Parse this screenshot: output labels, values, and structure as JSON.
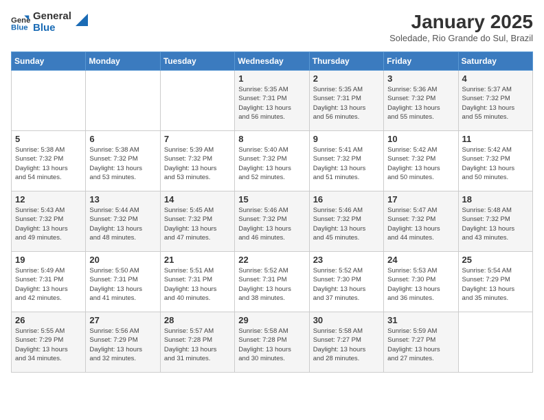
{
  "logo": {
    "text_general": "General",
    "text_blue": "Blue"
  },
  "title": "January 2025",
  "subtitle": "Soledade, Rio Grande do Sul, Brazil",
  "weekdays": [
    "Sunday",
    "Monday",
    "Tuesday",
    "Wednesday",
    "Thursday",
    "Friday",
    "Saturday"
  ],
  "weeks": [
    [
      {
        "day": "",
        "info": ""
      },
      {
        "day": "",
        "info": ""
      },
      {
        "day": "",
        "info": ""
      },
      {
        "day": "1",
        "info": "Sunrise: 5:35 AM\nSunset: 7:31 PM\nDaylight: 13 hours\nand 56 minutes."
      },
      {
        "day": "2",
        "info": "Sunrise: 5:35 AM\nSunset: 7:31 PM\nDaylight: 13 hours\nand 56 minutes."
      },
      {
        "day": "3",
        "info": "Sunrise: 5:36 AM\nSunset: 7:32 PM\nDaylight: 13 hours\nand 55 minutes."
      },
      {
        "day": "4",
        "info": "Sunrise: 5:37 AM\nSunset: 7:32 PM\nDaylight: 13 hours\nand 55 minutes."
      }
    ],
    [
      {
        "day": "5",
        "info": "Sunrise: 5:38 AM\nSunset: 7:32 PM\nDaylight: 13 hours\nand 54 minutes."
      },
      {
        "day": "6",
        "info": "Sunrise: 5:38 AM\nSunset: 7:32 PM\nDaylight: 13 hours\nand 53 minutes."
      },
      {
        "day": "7",
        "info": "Sunrise: 5:39 AM\nSunset: 7:32 PM\nDaylight: 13 hours\nand 53 minutes."
      },
      {
        "day": "8",
        "info": "Sunrise: 5:40 AM\nSunset: 7:32 PM\nDaylight: 13 hours\nand 52 minutes."
      },
      {
        "day": "9",
        "info": "Sunrise: 5:41 AM\nSunset: 7:32 PM\nDaylight: 13 hours\nand 51 minutes."
      },
      {
        "day": "10",
        "info": "Sunrise: 5:42 AM\nSunset: 7:32 PM\nDaylight: 13 hours\nand 50 minutes."
      },
      {
        "day": "11",
        "info": "Sunrise: 5:42 AM\nSunset: 7:32 PM\nDaylight: 13 hours\nand 50 minutes."
      }
    ],
    [
      {
        "day": "12",
        "info": "Sunrise: 5:43 AM\nSunset: 7:32 PM\nDaylight: 13 hours\nand 49 minutes."
      },
      {
        "day": "13",
        "info": "Sunrise: 5:44 AM\nSunset: 7:32 PM\nDaylight: 13 hours\nand 48 minutes."
      },
      {
        "day": "14",
        "info": "Sunrise: 5:45 AM\nSunset: 7:32 PM\nDaylight: 13 hours\nand 47 minutes."
      },
      {
        "day": "15",
        "info": "Sunrise: 5:46 AM\nSunset: 7:32 PM\nDaylight: 13 hours\nand 46 minutes."
      },
      {
        "day": "16",
        "info": "Sunrise: 5:46 AM\nSunset: 7:32 PM\nDaylight: 13 hours\nand 45 minutes."
      },
      {
        "day": "17",
        "info": "Sunrise: 5:47 AM\nSunset: 7:32 PM\nDaylight: 13 hours\nand 44 minutes."
      },
      {
        "day": "18",
        "info": "Sunrise: 5:48 AM\nSunset: 7:32 PM\nDaylight: 13 hours\nand 43 minutes."
      }
    ],
    [
      {
        "day": "19",
        "info": "Sunrise: 5:49 AM\nSunset: 7:31 PM\nDaylight: 13 hours\nand 42 minutes."
      },
      {
        "day": "20",
        "info": "Sunrise: 5:50 AM\nSunset: 7:31 PM\nDaylight: 13 hours\nand 41 minutes."
      },
      {
        "day": "21",
        "info": "Sunrise: 5:51 AM\nSunset: 7:31 PM\nDaylight: 13 hours\nand 40 minutes."
      },
      {
        "day": "22",
        "info": "Sunrise: 5:52 AM\nSunset: 7:31 PM\nDaylight: 13 hours\nand 38 minutes."
      },
      {
        "day": "23",
        "info": "Sunrise: 5:52 AM\nSunset: 7:30 PM\nDaylight: 13 hours\nand 37 minutes."
      },
      {
        "day": "24",
        "info": "Sunrise: 5:53 AM\nSunset: 7:30 PM\nDaylight: 13 hours\nand 36 minutes."
      },
      {
        "day": "25",
        "info": "Sunrise: 5:54 AM\nSunset: 7:29 PM\nDaylight: 13 hours\nand 35 minutes."
      }
    ],
    [
      {
        "day": "26",
        "info": "Sunrise: 5:55 AM\nSunset: 7:29 PM\nDaylight: 13 hours\nand 34 minutes."
      },
      {
        "day": "27",
        "info": "Sunrise: 5:56 AM\nSunset: 7:29 PM\nDaylight: 13 hours\nand 32 minutes."
      },
      {
        "day": "28",
        "info": "Sunrise: 5:57 AM\nSunset: 7:28 PM\nDaylight: 13 hours\nand 31 minutes."
      },
      {
        "day": "29",
        "info": "Sunrise: 5:58 AM\nSunset: 7:28 PM\nDaylight: 13 hours\nand 30 minutes."
      },
      {
        "day": "30",
        "info": "Sunrise: 5:58 AM\nSunset: 7:27 PM\nDaylight: 13 hours\nand 28 minutes."
      },
      {
        "day": "31",
        "info": "Sunrise: 5:59 AM\nSunset: 7:27 PM\nDaylight: 13 hours\nand 27 minutes."
      },
      {
        "day": "",
        "info": ""
      }
    ]
  ]
}
